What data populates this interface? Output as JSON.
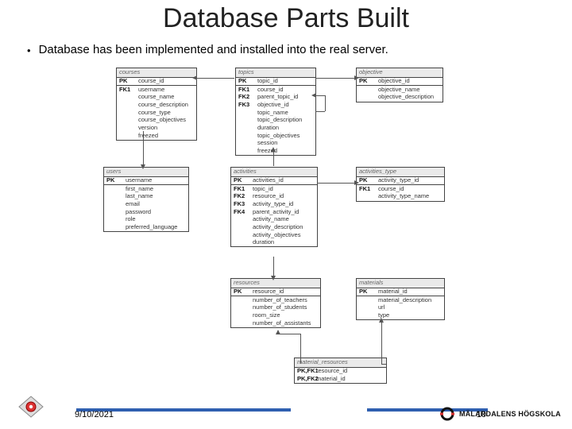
{
  "title": "Database Parts Built",
  "bullet": "Database has been implemented and installed into the real server.",
  "footer": {
    "date": "9/10/2021",
    "page": "10",
    "brand": "MÄLARDALENS HÖGSKOLA"
  },
  "tables": {
    "courses": {
      "name": "courses",
      "pk": [
        [
          "PK",
          "course_id"
        ]
      ],
      "fields": [
        [
          "FK1",
          "username"
        ],
        [
          "",
          "course_name"
        ],
        [
          "",
          "course_description"
        ],
        [
          "",
          "course_type"
        ],
        [
          "",
          "course_objectives"
        ],
        [
          "",
          "version"
        ],
        [
          "",
          "freezed"
        ]
      ]
    },
    "topics": {
      "name": "topics",
      "pk": [
        [
          "PK",
          "topic_id"
        ]
      ],
      "fields": [
        [
          "FK1",
          "course_id"
        ],
        [
          "FK2",
          "parent_topic_id"
        ],
        [
          "FK3",
          "objective_id"
        ],
        [
          "",
          "topic_name"
        ],
        [
          "",
          "topic_description"
        ],
        [
          "",
          "duration"
        ],
        [
          "",
          "topic_objectives"
        ],
        [
          "",
          "session"
        ],
        [
          "",
          "freezed"
        ]
      ]
    },
    "objective": {
      "name": "objective",
      "pk": [
        [
          "PK",
          "objective_id"
        ]
      ],
      "fields": [
        [
          "",
          "objective_name"
        ],
        [
          "",
          "objective_description"
        ]
      ]
    },
    "users": {
      "name": "users",
      "pk": [
        [
          "PK",
          "username"
        ]
      ],
      "fields": [
        [
          "",
          "first_name"
        ],
        [
          "",
          "last_name"
        ],
        [
          "",
          "email"
        ],
        [
          "",
          "password"
        ],
        [
          "",
          "role"
        ],
        [
          "",
          "preferred_language"
        ]
      ]
    },
    "activities": {
      "name": "activities",
      "pk": [
        [
          "PK",
          "activities_id"
        ]
      ],
      "fields": [
        [
          "FK1",
          "topic_id"
        ],
        [
          "FK2",
          "resource_id"
        ],
        [
          "FK3",
          "activity_type_id"
        ],
        [
          "FK4",
          "parent_activity_id"
        ],
        [
          "",
          "activity_name"
        ],
        [
          "",
          "activity_description"
        ],
        [
          "",
          "activity_objectives"
        ],
        [
          "",
          "duration"
        ]
      ]
    },
    "activities_type": {
      "name": "activities_type",
      "pk": [
        [
          "PK",
          "activity_type_id"
        ]
      ],
      "fields": [
        [
          "FK1",
          "course_id"
        ],
        [
          "",
          "activity_type_name"
        ]
      ]
    },
    "resources": {
      "name": "resources",
      "pk": [
        [
          "PK",
          "resource_id"
        ]
      ],
      "fields": [
        [
          "",
          "number_of_teachers"
        ],
        [
          "",
          "number_of_students"
        ],
        [
          "",
          "room_size"
        ],
        [
          "",
          "number_of_assistants"
        ]
      ]
    },
    "materials": {
      "name": "materials",
      "pk": [
        [
          "PK",
          "material_id"
        ]
      ],
      "fields": [
        [
          "",
          "material_description"
        ],
        [
          "",
          "url"
        ],
        [
          "",
          "type"
        ]
      ]
    },
    "material_resources": {
      "name": "material_resources",
      "pk": [
        [
          "PK,FK1",
          "resource_id"
        ],
        [
          "PK,FK2",
          "material_id"
        ]
      ],
      "fields": []
    }
  }
}
